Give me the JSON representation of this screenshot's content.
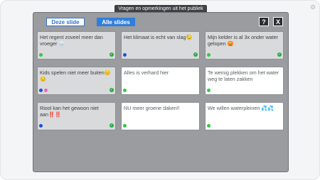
{
  "window": {
    "title": "Vragen en opmerkingen uit het publiek",
    "tabs": [
      {
        "label": "Deze slide"
      },
      {
        "label": "Alle slides"
      }
    ],
    "help_label": "?",
    "close_label": "X"
  },
  "colors": {
    "accent": "#2f7ddc",
    "panel": "#9a9c9f",
    "green": "#2ecc40",
    "check": "#27a844",
    "blue": "#1f4fd8",
    "pink": "#e86ab0"
  },
  "cards": [
    {
      "text": "Het regent zoveel meer dan vroeger 🌧️",
      "dots": [
        "#2ecc40"
      ],
      "checked": true,
      "highlight": true
    },
    {
      "text": "Het klimaat is echt van slag😓",
      "dots": [
        "#1f4fd8"
      ],
      "checked": true,
      "highlight": true
    },
    {
      "text": "Mijn kelder is al 3x onder water gelopen 😡",
      "dots": [
        "#2ecc40"
      ],
      "checked": true,
      "highlight": true
    },
    {
      "text": "Kids spelen niet meer buiten😔😔",
      "dots": [
        "#1f4fd8",
        "#e86ab0"
      ],
      "checked": true,
      "highlight": true
    },
    {
      "text": "Alles is verhard hier",
      "dots": [
        "#2ecc40"
      ],
      "checked": false,
      "highlight": false
    },
    {
      "text": "Te weinig plekken om het water weg te laten zakken",
      "dots": [
        "#2ecc40"
      ],
      "checked": false,
      "highlight": false
    },
    {
      "text": "Riool kan het gewoon niet aan‼️‼️",
      "dots": [
        "#1f4fd8"
      ],
      "checked": true,
      "highlight": true
    },
    {
      "text": "NU meer groene daken!!",
      "dots": [
        "#2ecc40"
      ],
      "checked": false,
      "highlight": false
    },
    {
      "text": "We willen waterpleinen 💦💦",
      "dots": [
        "#2ecc40"
      ],
      "checked": false,
      "highlight": false
    }
  ]
}
